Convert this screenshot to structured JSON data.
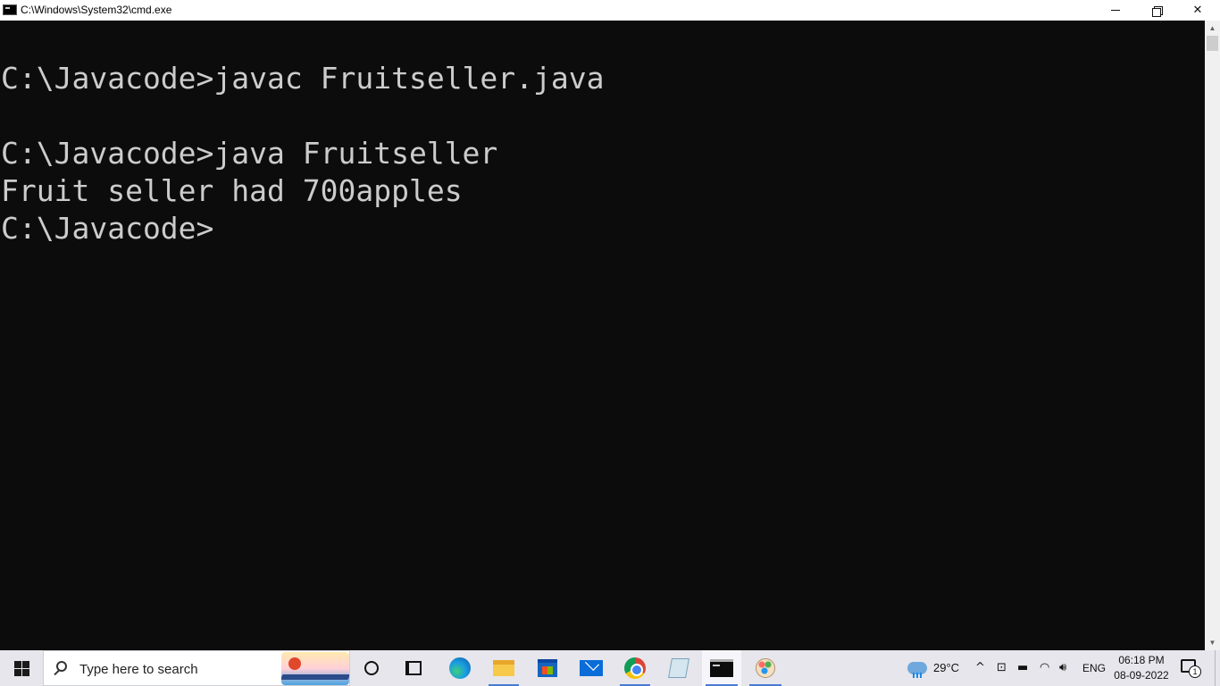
{
  "window": {
    "title": "C:\\Windows\\System32\\cmd.exe",
    "minimize_glyph": "",
    "close_glyph": "✕"
  },
  "console": {
    "lines": [
      "C:\\Javacode>javac Fruitseller.java",
      "C:\\Javacode>java Fruitseller",
      "Fruit seller had 700apples",
      "C:\\Javacode>"
    ]
  },
  "scrollbar": {
    "up_glyph": "▲",
    "down_glyph": "▼"
  },
  "taskbar": {
    "search_placeholder": "Type here to search",
    "pinned_apps": [
      "cortana-icon",
      "task-view-icon",
      "edge-icon",
      "file-explorer-icon",
      "store-icon",
      "mail-icon",
      "chrome-icon",
      "notepad-icon",
      "cmd-icon",
      "paint-icon"
    ],
    "weather": "29°C",
    "tray": {
      "chevron": "^",
      "meet": "⊡",
      "battery": "▬",
      "wifi": "◠",
      "volume": "🔊︎",
      "language": "ENG"
    },
    "clock": {
      "time": "06:18 PM",
      "date": "08-09-2022"
    },
    "notification_count": "1"
  },
  "colors": {
    "console_bg": "#0c0c0c",
    "console_fg": "#cccccc",
    "taskbar_bg": "#e6e6ec"
  }
}
